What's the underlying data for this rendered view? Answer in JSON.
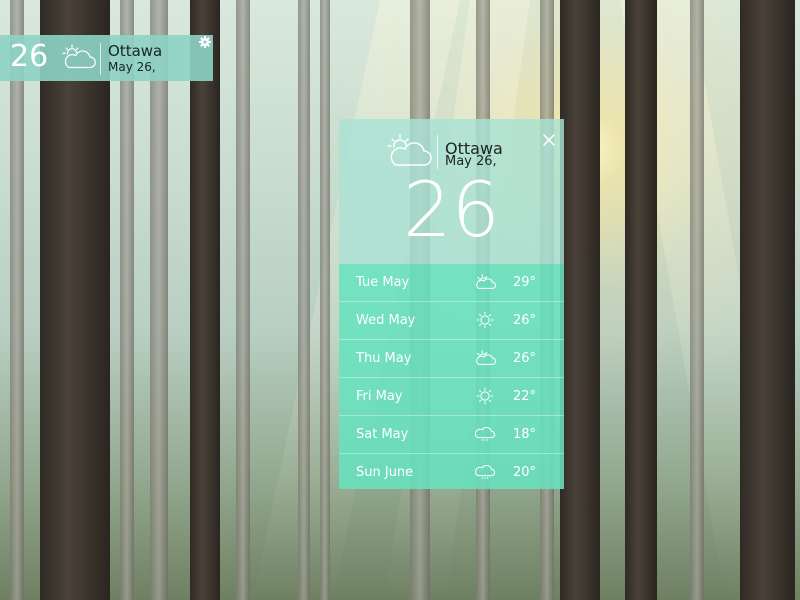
{
  "mini_widget": {
    "temperature": "26",
    "icon": "partly-cloudy-icon",
    "city": "Ottawa",
    "date": "May 26,",
    "settings_icon": "gear-icon"
  },
  "main_widget": {
    "icon": "partly-cloudy-icon",
    "city": "Ottawa",
    "date": "May 26,",
    "temperature": "26",
    "close_icon": "close-icon",
    "forecast": [
      {
        "day": "Tue May",
        "icon": "partly-cloudy-icon",
        "temp": "29°"
      },
      {
        "day": "Wed May",
        "icon": "sun-icon",
        "temp": "26°"
      },
      {
        "day": "Thu May",
        "icon": "partly-cloudy-icon",
        "temp": "26°"
      },
      {
        "day": "Fri May",
        "icon": "sun-icon",
        "temp": "22°"
      },
      {
        "day": "Sat May",
        "icon": "rain-cloud-icon",
        "temp": "18°"
      },
      {
        "day": "Sun June",
        "icon": "rain-cloud-icon",
        "temp": "20°"
      }
    ]
  },
  "colors": {
    "widget_top": "#aae2d4",
    "forecast_bg": "#68e1be",
    "mini_bg": "#8dd3c4"
  }
}
